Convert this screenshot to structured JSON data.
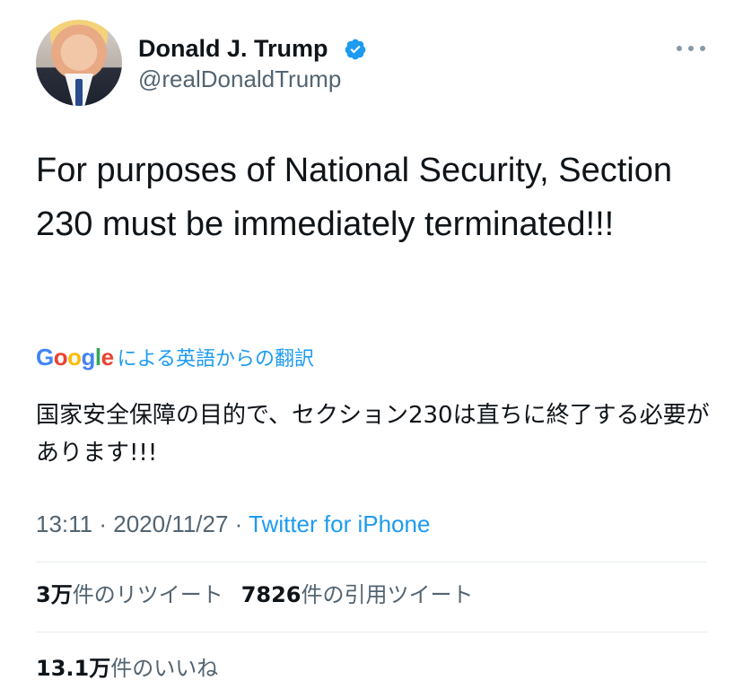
{
  "header": {
    "display_name": "Donald J. Trump",
    "handle": "@realDonaldTrump"
  },
  "tweet": {
    "text": "For purposes of National Security, Section 230 must be immediately terminated!!!"
  },
  "translation": {
    "provider_letters": [
      "G",
      "o",
      "o",
      "g",
      "l",
      "e"
    ],
    "label": "による英語からの翻訳",
    "text": "国家安全保障の目的で、セクション230は直ちに終了する必要があります!!!"
  },
  "meta": {
    "time": "13:11",
    "separator": " · ",
    "date": "2020/11/27",
    "source": "Twitter for iPhone"
  },
  "stats": {
    "retweets_count": "3万",
    "retweets_label": "件のリツイート",
    "quotes_count": "7826",
    "quotes_label": "件の引用ツイート",
    "likes_count": "13.1万",
    "likes_label": "件のいいね"
  },
  "colors": {
    "accent": "#1d9bf0",
    "secondary_text": "#536471",
    "primary_text": "#0f1419"
  },
  "icons": {
    "verified": "verified-badge-icon",
    "more": "more-horizontal-icon"
  }
}
